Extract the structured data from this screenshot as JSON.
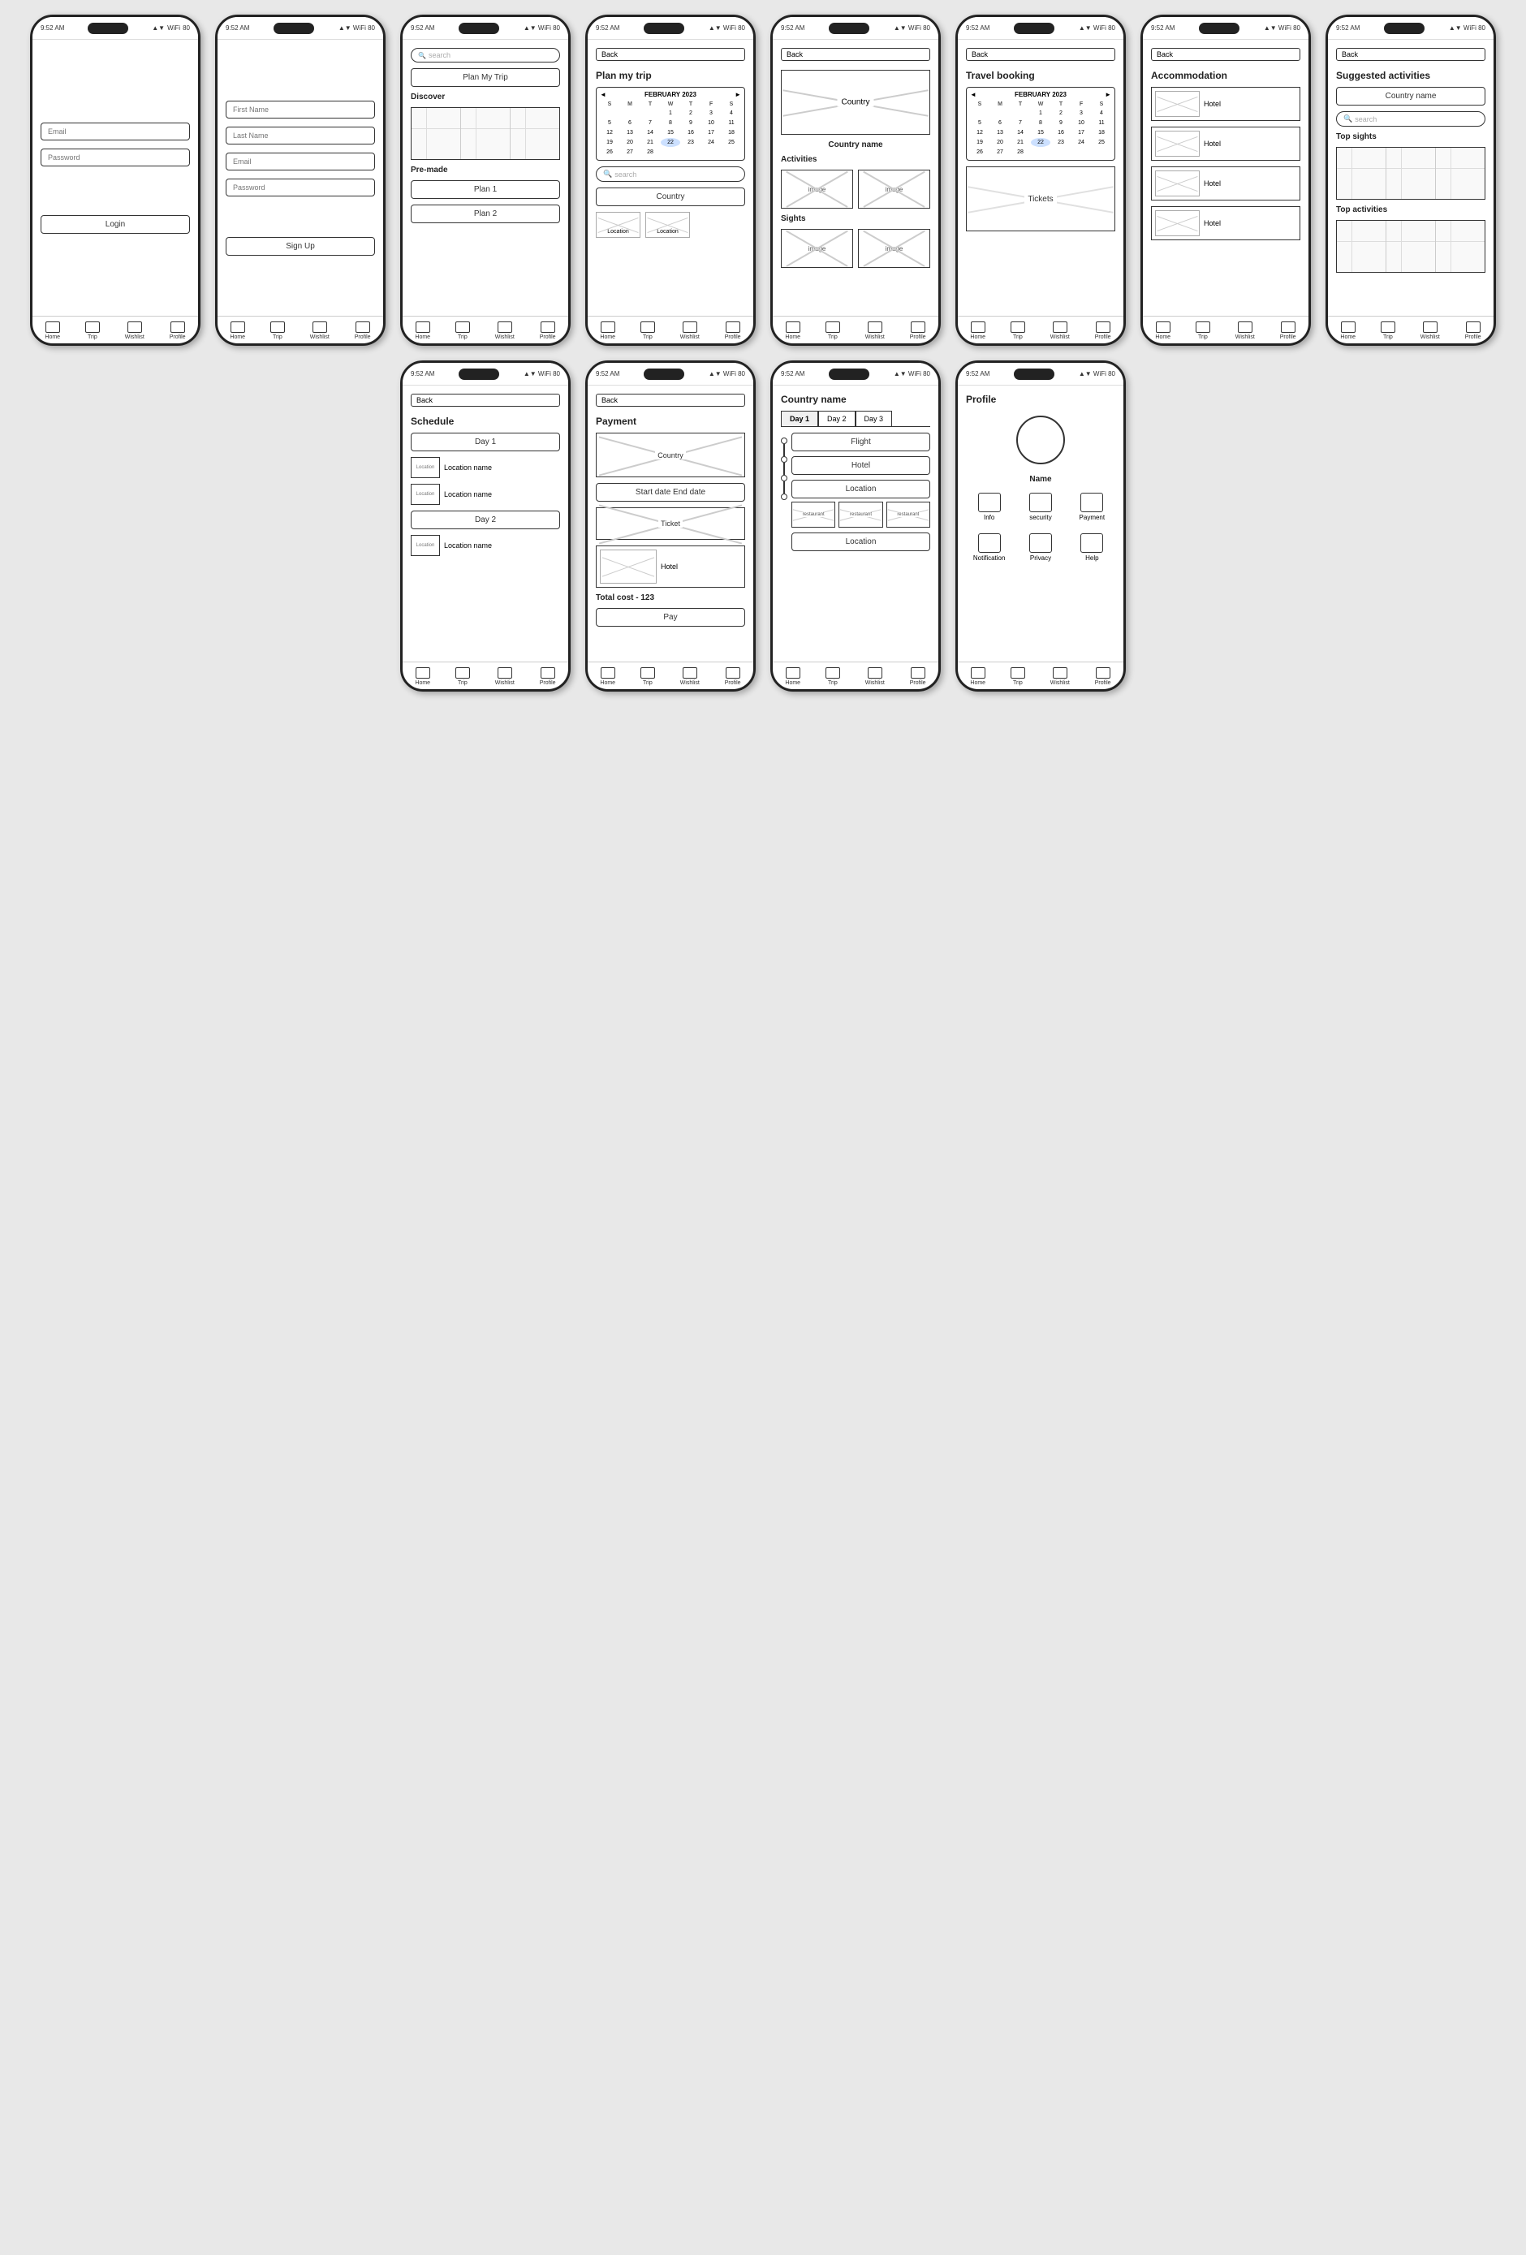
{
  "status_bar": {
    "time": "9:52 AM",
    "icons": "▲ ▼ WiFi 80"
  },
  "nav": {
    "home": "Home",
    "trip": "Trip",
    "wishlist": "Wishlist",
    "profile": "Profile"
  },
  "screens": {
    "login": {
      "email_placeholder": "Email",
      "password_placeholder": "Password",
      "login_btn": "Login"
    },
    "signup": {
      "first_name": "First Name",
      "last_name": "Last Name",
      "email": "Email",
      "password": "Password",
      "signup_btn": "Sign Up"
    },
    "home": {
      "search_placeholder": "search",
      "plan_btn": "Plan My Trip",
      "discover_label": "Discover",
      "premade_label": "Pre-made",
      "plan1_btn": "Plan 1",
      "plan2_btn": "Plan 2"
    },
    "plan_trip": {
      "back": "Back",
      "title": "Plan my trip",
      "calendar_month": "FEBRUARY 2023",
      "days": [
        "S",
        "M",
        "T",
        "W",
        "T",
        "F",
        "S"
      ],
      "weeks": [
        [
          "",
          "",
          "",
          "1",
          "2",
          "3",
          "4"
        ],
        [
          "5",
          "6",
          "7",
          "8",
          "9",
          "10",
          "11"
        ],
        [
          "12",
          "13",
          "14",
          "15",
          "16",
          "17",
          "18"
        ],
        [
          "19",
          "20",
          "21",
          "22",
          "23",
          "24",
          "25"
        ],
        [
          "26",
          "27",
          "28",
          "",
          "",
          "",
          ""
        ]
      ],
      "highlighted_day": "22",
      "search_placeholder": "search",
      "country_btn": "Country",
      "location1": "Location",
      "location2": "Location"
    },
    "country_page": {
      "back": "Back",
      "country_label": "Country",
      "country_name": "Country name",
      "activities_label": "Activities",
      "image1": "image",
      "image2": "image",
      "sights_label": "Sights",
      "image3": "image",
      "image4": "image"
    },
    "travel_booking": {
      "back": "Back",
      "title": "Travel booking",
      "calendar_month": "FEBRUARY 2023",
      "days": [
        "S",
        "M",
        "T",
        "W",
        "T",
        "F",
        "S"
      ],
      "weeks": [
        [
          "",
          "",
          "",
          "1",
          "2",
          "3",
          "4"
        ],
        [
          "5",
          "6",
          "7",
          "8",
          "9",
          "10",
          "11"
        ],
        [
          "12",
          "13",
          "14",
          "15",
          "16",
          "17",
          "18"
        ],
        [
          "19",
          "20",
          "21",
          "22",
          "23",
          "24",
          "25"
        ],
        [
          "26",
          "27",
          "28",
          "",
          "",
          "",
          ""
        ]
      ],
      "highlighted_day": "22",
      "tickets_label": "Tickets"
    },
    "accommodation": {
      "back": "Back",
      "title": "Accommodation",
      "hotels": [
        "Hotel",
        "Hotel",
        "Hotel",
        "Hotel"
      ]
    },
    "suggested_activities": {
      "back": "Back",
      "title": "Suggested activities",
      "country_name_btn": "Country name",
      "search_placeholder": "search",
      "top_sights_label": "Top sights",
      "top_activities_label": "Top activities"
    },
    "schedule": {
      "back": "Back",
      "title": "Schedule",
      "day1_label": "Day 1",
      "loc1_name": "Location name",
      "loc1_img": "Location",
      "loc2_name": "Location name",
      "loc2_img": "Location",
      "day2_label": "Day 2",
      "loc3_name": "Location name",
      "loc3_img": "Location"
    },
    "payment": {
      "back": "Back",
      "title": "Payment",
      "country_label": "Country",
      "date_range": "Start date  End date",
      "ticket_label": "Ticket",
      "hotel_label": "Hotel",
      "total_label": "Total cost - 123",
      "pay_btn": "Pay"
    },
    "country_detail": {
      "title": "Country name",
      "day1": "Day 1",
      "day2": "Day 2",
      "day3": "Day 3",
      "flight_label": "Flight",
      "hotel_label": "Hotel",
      "location_label": "Location",
      "restaurant1": "restaurant",
      "restaurant2": "restaurant",
      "restaurant3": "restaurant",
      "location2_label": "Location"
    },
    "profile": {
      "title": "Profile",
      "name_label": "Name",
      "info_label": "Info",
      "security_label": "security",
      "payment_label": "Payment",
      "notification_label": "Notification",
      "privacy_label": "Privacy",
      "help_label": "Help"
    }
  }
}
